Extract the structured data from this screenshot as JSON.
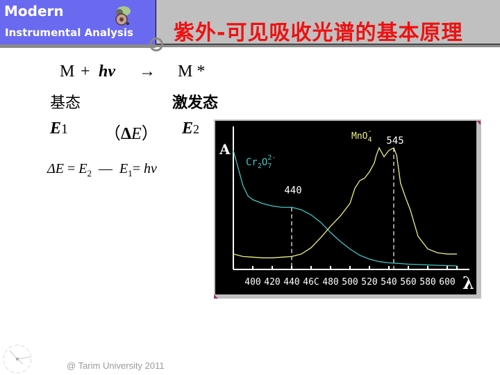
{
  "header": {
    "course_title_line1": "Modern",
    "course_title_line2": "Instrumental Analysis",
    "logo_icon": "atom-molecule-logo",
    "slide_title": "紫外-可见吸收光谱的基本原理",
    "colors": {
      "left_panel": "#6a6af0",
      "right_panel": "#c0c0c0",
      "title": "#ee1111",
      "band": "#8a8a8a"
    }
  },
  "equations": {
    "reaction_M": "M",
    "reaction_plus": "+",
    "reaction_hv": "hν",
    "reaction_arrow": "→",
    "reaction_Mstar": "M *",
    "ground_state": "基态",
    "excited_state": "激发态",
    "E1": "E",
    "E1_sub": "1",
    "deltaE_open": "（",
    "deltaE_delta": "Δ",
    "deltaE_E": "E",
    "deltaE_close": "）",
    "E2": "E",
    "E2_sub": "2",
    "energy_eq_delta": "ΔE",
    "energy_eq_eq1": "=",
    "energy_eq_E2": "E",
    "energy_eq_E2_sub": "2",
    "energy_eq_minus": "—",
    "energy_eq_E1": "E",
    "energy_eq_E1_sub": "1",
    "energy_eq_eq2": "=",
    "energy_eq_hv": "hν"
  },
  "chart_data": {
    "type": "line",
    "title": "",
    "xlabel": "λ",
    "ylabel": "A",
    "x_ticks": [
      "400",
      "420",
      "440",
      "46C",
      "480",
      "500",
      "520",
      "540",
      "560",
      "580",
      "600"
    ],
    "xlim": [
      380,
      612
    ],
    "ylim": [
      0,
      1.0
    ],
    "grid": false,
    "series": [
      {
        "name": "Cr2O7 2-",
        "label_main": "Cr",
        "label_sub1": "2",
        "label_mid": "O",
        "label_sub2": "7",
        "label_sup": "2-",
        "color": "#40c8c8",
        "x": [
          380,
          385,
          390,
          395,
          400,
          410,
          420,
          430,
          440,
          445,
          450,
          460,
          470,
          480,
          490,
          500,
          510,
          520,
          530,
          540,
          550,
          560,
          570,
          580,
          590,
          600,
          610
        ],
        "y": [
          0.92,
          0.78,
          0.64,
          0.56,
          0.53,
          0.5,
          0.48,
          0.47,
          0.47,
          0.46,
          0.45,
          0.41,
          0.35,
          0.27,
          0.2,
          0.14,
          0.09,
          0.06,
          0.04,
          0.03,
          0.025,
          0.02,
          0.017,
          0.014,
          0.011,
          0.008,
          0.006
        ]
      },
      {
        "name": "MnO4 -",
        "label_main": "MnO",
        "label_sub": "4",
        "label_sup": "-",
        "color": "#f0f080",
        "x": [
          380,
          390,
          400,
          410,
          420,
          430,
          440,
          450,
          460,
          470,
          480,
          490,
          500,
          505,
          510,
          515,
          520,
          525,
          527,
          530,
          535,
          540,
          545,
          548,
          552,
          557,
          562,
          570,
          580,
          590,
          600,
          610
        ],
        "y": [
          0.1,
          0.08,
          0.075,
          0.07,
          0.07,
          0.075,
          0.08,
          0.1,
          0.15,
          0.23,
          0.32,
          0.4,
          0.5,
          0.62,
          0.68,
          0.7,
          0.75,
          0.82,
          0.88,
          0.94,
          0.87,
          0.92,
          0.94,
          0.88,
          0.66,
          0.55,
          0.45,
          0.24,
          0.14,
          0.11,
          0.1,
          0.1
        ]
      }
    ],
    "annotations": [
      {
        "text": "440",
        "x": 440,
        "type": "dashed-vline"
      },
      {
        "text": "545",
        "x": 545,
        "type": "dashed-vline"
      }
    ]
  },
  "footer": {
    "copyright": "@ Tarim University 2011",
    "clock_icon": "clock-icon"
  }
}
